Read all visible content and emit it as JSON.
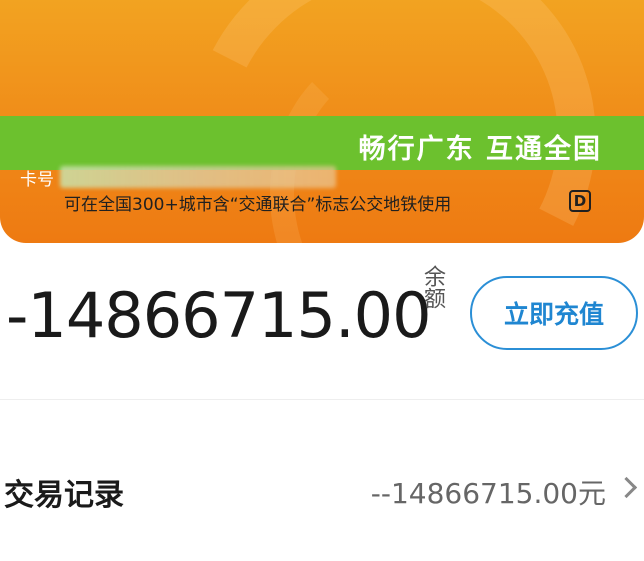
{
  "card": {
    "slogan": "畅行广东 互通全国",
    "number_label": "卡号",
    "notice": "可在全国300+城市含“交通联合”标志公交地铁使用",
    "badge": "D"
  },
  "balance": {
    "amount": "-14866715.00",
    "label": "余额"
  },
  "recharge_button": "立即充值",
  "transactions": {
    "label": "交易记录",
    "value": "--14866715.00元"
  },
  "colors": {
    "card_orange": "#f08a18",
    "band_green": "#6cc12e",
    "accent_blue": "#1f86d1"
  },
  "icons": {
    "chevron": "chevron-right-icon"
  }
}
